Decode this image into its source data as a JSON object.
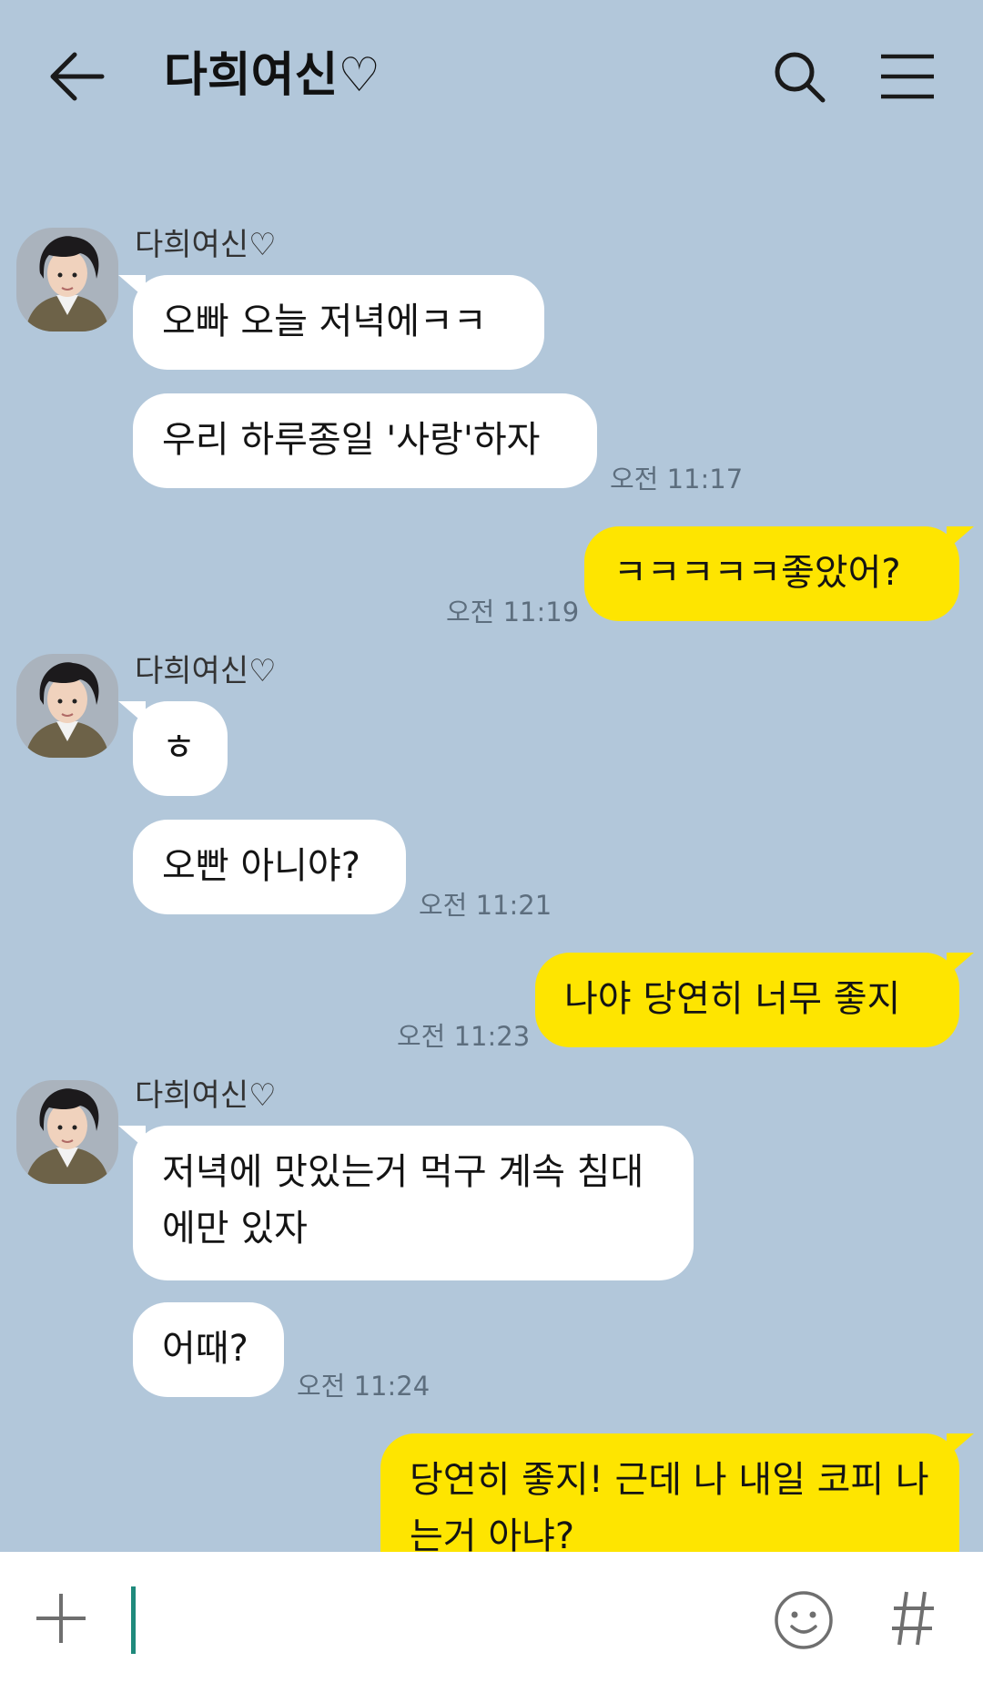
{
  "header": {
    "title": "다희여신♡",
    "icons": [
      "back-arrow-icon",
      "search-icon",
      "menu-icon"
    ]
  },
  "chat": {
    "background": "#b2c7da",
    "incoming_bubble_color": "#ffffff",
    "outgoing_bubble_color": "#fee500",
    "messages": [
      {
        "sender": "다희여신♡",
        "text": "오빠 오늘 저녁에ㅋㅋ",
        "direction": "in"
      },
      {
        "text": "우리 하루종일 '사랑'하자",
        "direction": "in",
        "time": "오전 11:17"
      },
      {
        "text": "ㅋㅋㅋㅋㅋ좋았어?",
        "direction": "out",
        "time": "오전 11:19"
      },
      {
        "sender": "다희여신♡",
        "text": "ㅎ",
        "direction": "in"
      },
      {
        "text": "오빤 아니야?",
        "direction": "in",
        "time": "오전 11:21"
      },
      {
        "text": "나야 당연히 너무 좋지",
        "direction": "out",
        "time": "오전 11:23"
      },
      {
        "sender": "다희여신♡",
        "text": "저녁에 맛있는거 먹구 계속 침대에만 있자",
        "direction": "in"
      },
      {
        "text": "어때?",
        "direction": "in",
        "time": "오전 11:24"
      },
      {
        "text": "당연히 좋지! 근데 나 내일 코피 나는거 아냐?",
        "direction": "out"
      }
    ]
  },
  "input": {
    "value": "",
    "icons": [
      "plus-icon",
      "emoji-icon",
      "hashtag-icon"
    ],
    "cursor_color": "#1f8a7c"
  }
}
